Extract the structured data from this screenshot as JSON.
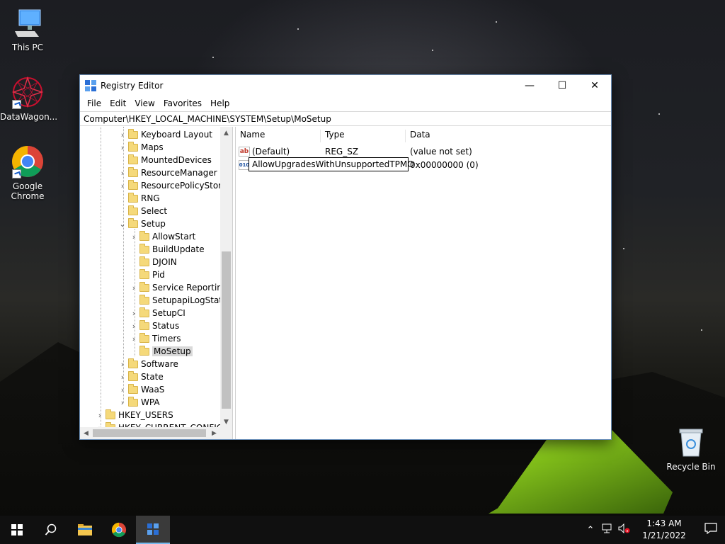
{
  "desktop": {
    "icons": [
      {
        "label": "This PC",
        "icon": "this-pc-icon"
      },
      {
        "label": "DataWagon...",
        "icon": "datawagon-icon"
      },
      {
        "label": "Google Chrome",
        "icon": "chrome-icon"
      },
      {
        "label": "Recycle Bin",
        "icon": "recycle-bin-icon"
      }
    ]
  },
  "window": {
    "title": "Registry Editor",
    "controls": {
      "minimize": "—",
      "maximize": "☐",
      "close": "✕"
    },
    "menu": [
      "File",
      "Edit",
      "View",
      "Favorites",
      "Help"
    ],
    "address": "Computer\\HKEY_LOCAL_MACHINE\\SYSTEM\\Setup\\MoSetup"
  },
  "tree": {
    "items": [
      {
        "label": "Keyboard Layout",
        "level": 3,
        "expander": "collapsed"
      },
      {
        "label": "Maps",
        "level": 3,
        "expander": "collapsed"
      },
      {
        "label": "MountedDevices",
        "level": 3,
        "expander": "none"
      },
      {
        "label": "ResourceManager",
        "level": 3,
        "expander": "collapsed"
      },
      {
        "label": "ResourcePolicyStore",
        "level": 3,
        "expander": "collapsed"
      },
      {
        "label": "RNG",
        "level": 3,
        "expander": "none"
      },
      {
        "label": "Select",
        "level": 3,
        "expander": "none"
      },
      {
        "label": "Setup",
        "level": 3,
        "expander": "expanded"
      },
      {
        "label": "AllowStart",
        "level": 4,
        "expander": "collapsed"
      },
      {
        "label": "BuildUpdate",
        "level": 4,
        "expander": "none"
      },
      {
        "label": "DJOIN",
        "level": 4,
        "expander": "none"
      },
      {
        "label": "Pid",
        "level": 4,
        "expander": "none"
      },
      {
        "label": "Service Reporting",
        "level": 4,
        "expander": "collapsed"
      },
      {
        "label": "SetupapiLogStatu",
        "level": 4,
        "expander": "none"
      },
      {
        "label": "SetupCI",
        "level": 4,
        "expander": "collapsed"
      },
      {
        "label": "Status",
        "level": 4,
        "expander": "collapsed"
      },
      {
        "label": "Timers",
        "level": 4,
        "expander": "collapsed"
      },
      {
        "label": "MoSetup",
        "level": 4,
        "expander": "none",
        "selected": true
      },
      {
        "label": "Software",
        "level": 3,
        "expander": "collapsed"
      },
      {
        "label": "State",
        "level": 3,
        "expander": "collapsed"
      },
      {
        "label": "WaaS",
        "level": 3,
        "expander": "collapsed"
      },
      {
        "label": "WPA",
        "level": 3,
        "expander": "collapsed"
      },
      {
        "label": "HKEY_USERS",
        "level": 1,
        "expander": "collapsed"
      },
      {
        "label": "HKEY_CURRENT_CONFIG",
        "level": 1,
        "expander": "collapsed"
      }
    ]
  },
  "values": {
    "columns": [
      "Name",
      "Type",
      "Data"
    ],
    "rows": [
      {
        "name": "(Default)",
        "type": "REG_SZ",
        "data": "(value not set)",
        "icon": "string-value-icon"
      },
      {
        "name": "AllowUpgradesWithUnsupportedTPMO",
        "type": "",
        "data": "0x00000000 (0)",
        "icon": "dword-value-icon",
        "editing": true
      }
    ]
  },
  "taskbar": {
    "time": "1:43 AM",
    "date": "1/21/2022",
    "tray": [
      "chevron-up-icon",
      "network-icon",
      "volume-muted-icon"
    ]
  }
}
